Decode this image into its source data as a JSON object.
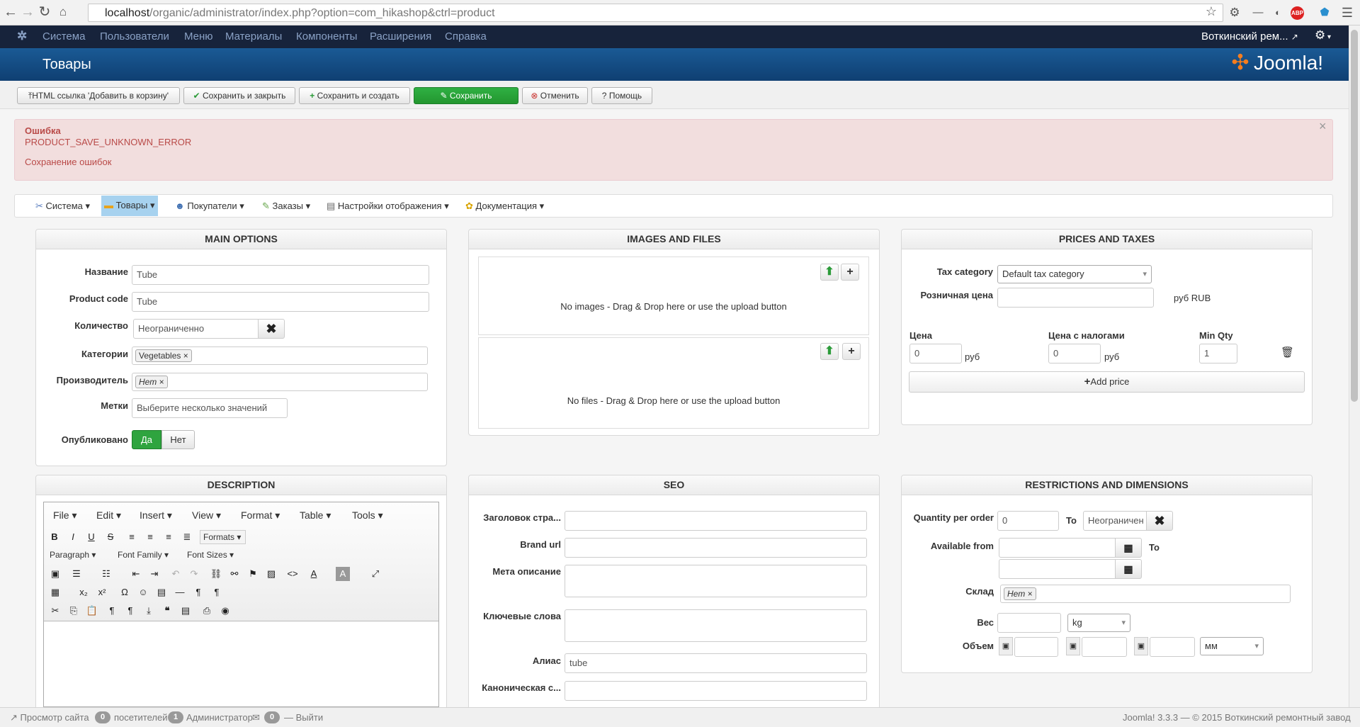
{
  "browser": {
    "url_host": "localhost",
    "url_path": "/organic/administrator/index.php?option=com_hikashop&ctrl=product",
    "icons": [
      "back-icon",
      "forward-icon",
      "reload-icon",
      "home-icon",
      "star-icon",
      "gear-icon",
      "extension-icon",
      "abp-icon",
      "menu-icon"
    ]
  },
  "topmenu": {
    "items": [
      "Система",
      "Пользователи",
      "Меню",
      "Материалы",
      "Компоненты",
      "Расширения",
      "Справка"
    ],
    "site_name": "Воткинский рем...",
    "gear": "⚙"
  },
  "header": {
    "title": "Товары",
    "logo_text": "Joomla!"
  },
  "toolbar": {
    "html_link": "HTML ссылка 'Добавить в корзину'",
    "save_close": "Сохранить и закрыть",
    "save_new": "Сохранить и создать",
    "save": "Сохранить",
    "cancel": "Отменить",
    "help": "Помощь"
  },
  "alert": {
    "heading": "Ошибка",
    "line1": "PRODUCT_SAVE_UNKNOWN_ERROR",
    "line2": "Сохранение ошибок",
    "close": "×"
  },
  "hikamenu": {
    "items": [
      "Система",
      "Товары",
      "Покупатели",
      "Заказы",
      "Настройки отображения",
      "Документация"
    ]
  },
  "main_options": {
    "title": "MAIN OPTIONS",
    "name_label": "Название",
    "name_value": "Tube",
    "code_label": "Product code",
    "code_value": "Tube",
    "qty_label": "Количество",
    "qty_value": "Неограниченно",
    "cat_label": "Категории",
    "cat_tag": "Vegetables",
    "maker_label": "Производитель",
    "maker_tag": "Нет",
    "tags_label": "Метки",
    "tags_placeholder": "Выберите несколько значений",
    "pub_label": "Опубликовано",
    "yes": "Да",
    "no": "Нет"
  },
  "images_files": {
    "title": "IMAGES AND FILES",
    "no_images": "No images - Drag & Drop here or use the upload button",
    "no_files": "No files - Drag & Drop here or use the upload button"
  },
  "prices": {
    "title": "PRICES AND TAXES",
    "tax_label": "Tax category",
    "tax_value": "Default tax category",
    "retail_label": "Розничная цена",
    "retail_unit": "руб RUB",
    "col_price": "Цена",
    "col_price_tax": "Цена с налогами",
    "col_minqty": "Min Qty",
    "price_value": "0",
    "price_unit": "руб",
    "price_tax_value": "0",
    "price_tax_unit": "руб",
    "minqty_value": "1",
    "add_price": "Add price"
  },
  "description": {
    "title": "DESCRIPTION",
    "menus": [
      "File",
      "Edit",
      "Insert",
      "View",
      "Format",
      "Table",
      "Tools"
    ],
    "formats": "Formats",
    "paragraph": "Paragraph",
    "font_family": "Font Family",
    "font_sizes": "Font Sizes"
  },
  "seo": {
    "title": "SEO",
    "page_title_label": "Заголовок стра...",
    "brand_url_label": "Brand url",
    "meta_desc_label": "Мета описание",
    "keywords_label": "Ключевые слова",
    "alias_label": "Алиас",
    "alias_value": "tube",
    "canonical_label": "Каноническая с..."
  },
  "restrictions": {
    "title": "RESTRICTIONS AND DIMENSIONS",
    "qty_order_label": "Quantity per order",
    "qty_from": "0",
    "to": "To",
    "qty_to": "Неограничен",
    "available_label": "Available from",
    "available_to": "To",
    "warehouse_label": "Склад",
    "warehouse_tag": "Нет",
    "weight_label": "Вес",
    "weight_unit": "kg",
    "volume_label": "Объем",
    "volume_unit": "мм"
  },
  "status": {
    "preview": "Просмотр сайта",
    "visitors_count": "0",
    "visitors": "посетителей",
    "admins_count": "1",
    "admins": "Администратор",
    "logout_count": "0",
    "logout": "Выйти",
    "footer": "Joomla! 3.3.3 — © 2015 Воткинский ремонтный завод"
  }
}
